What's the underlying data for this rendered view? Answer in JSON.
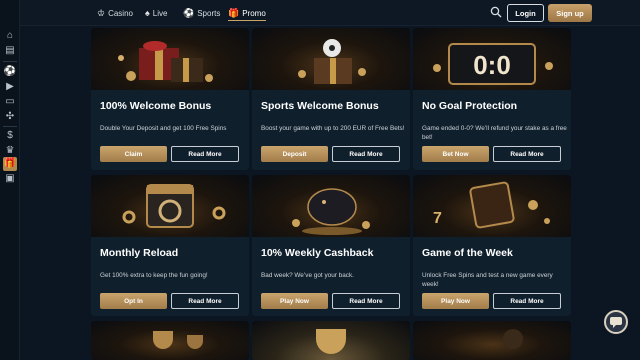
{
  "nav": {
    "items": [
      {
        "label": "Casino",
        "icon": "casino-icon",
        "glyph": "♔"
      },
      {
        "label": "Live",
        "icon": "live-icon",
        "glyph": "♠"
      },
      {
        "label": "Sports",
        "icon": "sports-icon",
        "glyph": "⚽"
      },
      {
        "label": "Promo",
        "icon": "promo-icon",
        "glyph": "🎁",
        "active": true
      }
    ],
    "login_label": "Login",
    "signup_label": "Sign up"
  },
  "sidebar": {
    "icons": [
      "home-icon",
      "slots-icon",
      "sports-ball-icon",
      "live-icon",
      "tv-icon",
      "pinwheel-icon",
      "bonus-icon",
      "crown-icon",
      "promo-gift-icon",
      "vip-icon"
    ]
  },
  "promos": [
    {
      "title": "100% Welcome Bonus",
      "desc": "Double Your Deposit and get 100 Free Spins",
      "primary": "Claim",
      "secondary": "Read More",
      "art": "gift-boxes"
    },
    {
      "title": "Sports Welcome Bonus",
      "desc": "Boost your game with up to 200 EUR of Free Bets!",
      "primary": "Deposit",
      "secondary": "Read More",
      "art": "soccer-gift"
    },
    {
      "title": "No Goal Protection",
      "desc": "Game ended 0-0? We’ll refund your stake as a free bet!",
      "primary": "Bet Now",
      "secondary": "Read More",
      "art": "scoreboard"
    },
    {
      "title": "Monthly Reload",
      "desc": "Get 100% extra to keep the fun going!",
      "primary": "Opt In",
      "secondary": "Read More",
      "art": "calendar"
    },
    {
      "title": "10% Weekly Cashback",
      "desc": "Bad week? We’ve got your back.",
      "primary": "Play Now",
      "secondary": "Read More",
      "art": "piggy-bank"
    },
    {
      "title": "Game of the Week",
      "desc": "Unlock Free Spins and test a new game every week!",
      "primary": "Play Now",
      "secondary": "Read More",
      "art": "slot-dice"
    }
  ],
  "scoreboard_text": "0:0",
  "colors": {
    "accent": "#b08a4c",
    "background": "#0c1622",
    "card": "#0f1f2c"
  }
}
